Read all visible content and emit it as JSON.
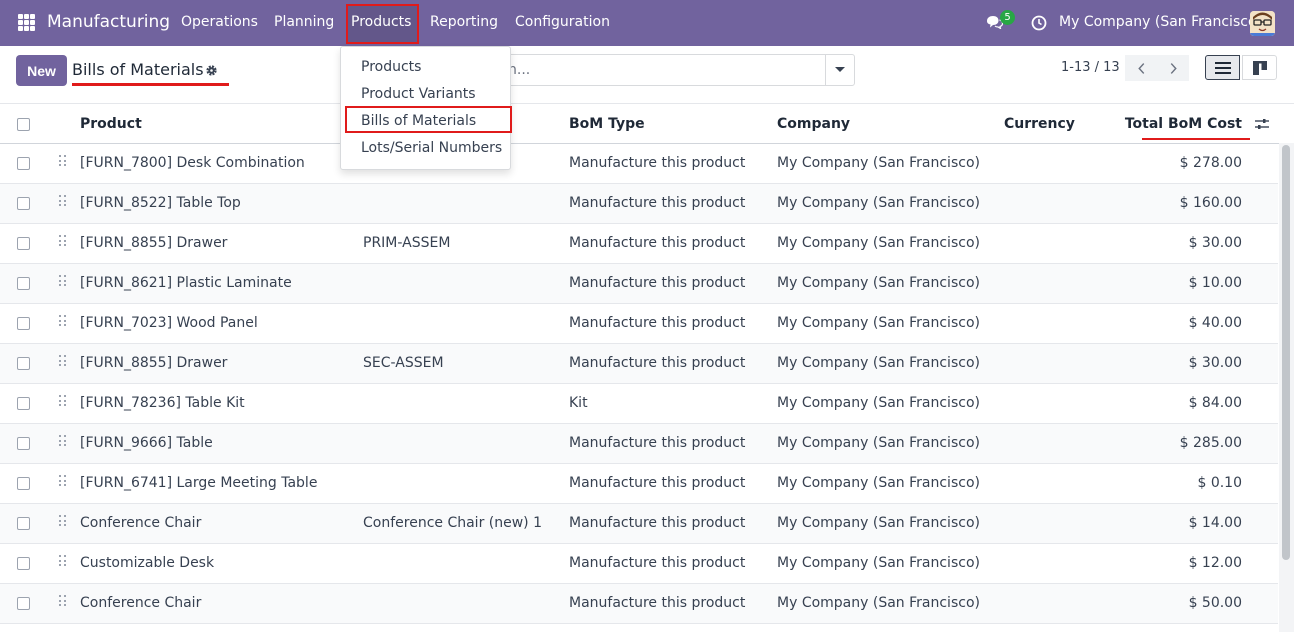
{
  "navbar": {
    "brand": "Manufacturing",
    "menu": [
      "Operations",
      "Planning",
      "Products",
      "Reporting",
      "Configuration"
    ],
    "chat_badge": "5",
    "company": "My Company (San Francisco)",
    "accent_color": "#71639e"
  },
  "control_panel": {
    "new_label": "New",
    "title": "Bills of Materials",
    "search_placeholder_visible": "h...",
    "pager": "1-13 / 13"
  },
  "products_menu": {
    "items": [
      "Products",
      "Product Variants",
      "Bills of Materials",
      "Lots/Serial Numbers"
    ]
  },
  "table": {
    "columns": {
      "product": "Product",
      "bom_type": "BoM Type",
      "company": "Company",
      "currency": "Currency",
      "total_cost": "Total BoM Cost"
    },
    "rows": [
      {
        "product": "[FURN_7800] Desk Combination",
        "reference": "",
        "bom_type": "Manufacture this product",
        "company": "My Company (San Francisco)",
        "currency": "",
        "cost": "$ 278.00"
      },
      {
        "product": "[FURN_8522] Table Top",
        "reference": "",
        "bom_type": "Manufacture this product",
        "company": "My Company (San Francisco)",
        "currency": "",
        "cost": "$ 160.00"
      },
      {
        "product": "[FURN_8855] Drawer",
        "reference": "PRIM-ASSEM",
        "bom_type": "Manufacture this product",
        "company": "My Company (San Francisco)",
        "currency": "",
        "cost": "$ 30.00"
      },
      {
        "product": "[FURN_8621] Plastic Laminate",
        "reference": "",
        "bom_type": "Manufacture this product",
        "company": "My Company (San Francisco)",
        "currency": "",
        "cost": "$ 10.00"
      },
      {
        "product": "[FURN_7023] Wood Panel",
        "reference": "",
        "bom_type": "Manufacture this product",
        "company": "My Company (San Francisco)",
        "currency": "",
        "cost": "$ 40.00"
      },
      {
        "product": "[FURN_8855] Drawer",
        "reference": "SEC-ASSEM",
        "bom_type": "Manufacture this product",
        "company": "My Company (San Francisco)",
        "currency": "",
        "cost": "$ 30.00"
      },
      {
        "product": "[FURN_78236] Table Kit",
        "reference": "",
        "bom_type": "Kit",
        "company": "My Company (San Francisco)",
        "currency": "",
        "cost": "$ 84.00"
      },
      {
        "product": "[FURN_9666] Table",
        "reference": "",
        "bom_type": "Manufacture this product",
        "company": "My Company (San Francisco)",
        "currency": "",
        "cost": "$ 285.00"
      },
      {
        "product": "[FURN_6741] Large Meeting Table",
        "reference": "",
        "bom_type": "Manufacture this product",
        "company": "My Company (San Francisco)",
        "currency": "",
        "cost": "$ 0.10"
      },
      {
        "product": "Conference Chair",
        "reference": "Conference Chair (new) 1",
        "bom_type": "Manufacture this product",
        "company": "My Company (San Francisco)",
        "currency": "",
        "cost": "$ 14.00"
      },
      {
        "product": "Customizable Desk",
        "reference": "",
        "bom_type": "Manufacture this product",
        "company": "My Company (San Francisco)",
        "currency": "",
        "cost": "$ 12.00"
      },
      {
        "product": "Conference Chair",
        "reference": "",
        "bom_type": "Manufacture this product",
        "company": "My Company (San Francisco)",
        "currency": "",
        "cost": "$ 50.00"
      }
    ]
  }
}
